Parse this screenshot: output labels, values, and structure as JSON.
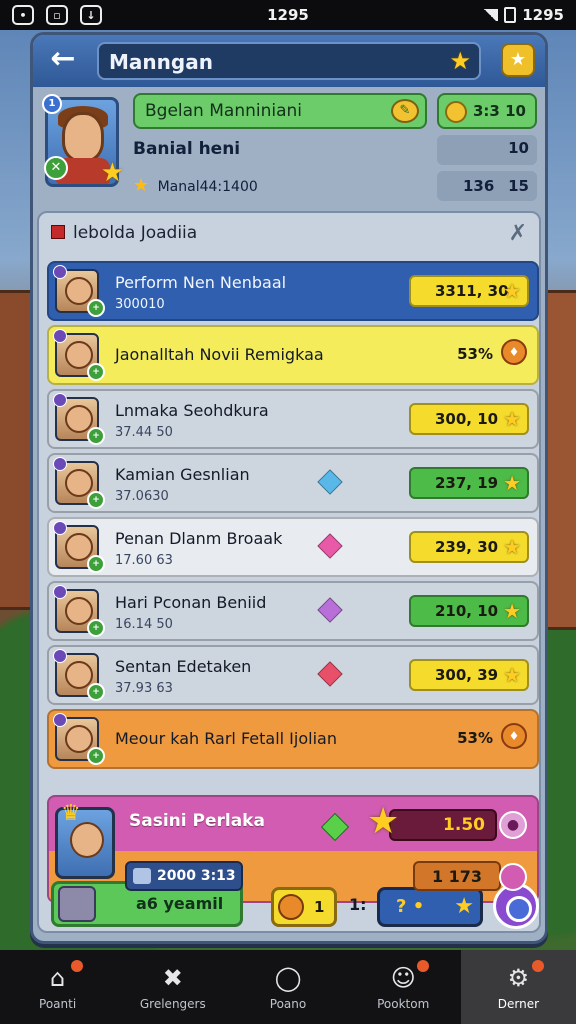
{
  "status_bar": {
    "time": "1295",
    "right_text": "1295"
  },
  "header": {
    "title": "Manngan"
  },
  "profile": {
    "name_bar": "Bgelan Manniniani",
    "coins": "3:3 10",
    "subtitle": "Banial heni",
    "subtitle_value": "10",
    "level_text": "Manal44:1400",
    "stat_a": "136",
    "stat_b": "15"
  },
  "list": {
    "title": "lebolda Joadiia",
    "rows": [
      {
        "name": "Perform Nen Nenbaal",
        "sub": "300010",
        "value": "3311, 30",
        "color": "blue",
        "kind": "value",
        "value_color": "yellow"
      },
      {
        "name": "Jaonalltah Novii Remigkaa",
        "sub": "",
        "value": "53%",
        "color": "yellow",
        "kind": "percent"
      },
      {
        "name": "Lnmaka Seohdkura",
        "sub": "37.44 50",
        "value": "300, 10",
        "color": "grey",
        "kind": "value",
        "value_color": "yellow"
      },
      {
        "name": "Kamian Gesnlian",
        "sub": "37.0630",
        "value": "237, 19",
        "color": "grey",
        "kind": "value",
        "value_color": "green",
        "gem": "#5ab8e8"
      },
      {
        "name": "Penan Dlanm Broaak",
        "sub": "17.60 63",
        "value": "239, 30",
        "color": "light",
        "kind": "value",
        "value_color": "yellow",
        "gem": "#e85aa8"
      },
      {
        "name": "Hari Pconan Beniid",
        "sub": "16.14 50",
        "value": "210, 10",
        "color": "grey",
        "kind": "value",
        "value_color": "green",
        "gem": "#b870d8"
      },
      {
        "name": "Sentan Edetaken",
        "sub": "37.93 63",
        "value": "300, 39",
        "color": "grey",
        "kind": "value",
        "value_color": "yellow",
        "gem": "#e8506a"
      },
      {
        "name": "Meour kah Rarl Fetall Ijolian",
        "sub": "",
        "value": "53%",
        "color": "orange",
        "kind": "percent"
      }
    ],
    "feature": {
      "name": "Sasini Perlaka",
      "timer": "1.50",
      "chip": "2000 3:13",
      "count": "1 173"
    }
  },
  "actions": {
    "green_label": "a6 yeamil",
    "yellow_label": "1",
    "mid_label": "1:",
    "blue_label": "? •"
  },
  "nav": [
    {
      "label": "Poanti",
      "icon": "home-icon",
      "glyph": "⌂",
      "dot": true,
      "active": false
    },
    {
      "label": "Grelengers",
      "icon": "crossed-swords-icon",
      "glyph": "✖",
      "dot": false,
      "active": false
    },
    {
      "label": "Poano",
      "icon": "circle-icon",
      "glyph": "◯",
      "dot": false,
      "active": false
    },
    {
      "label": "Pooktom",
      "icon": "person-icon",
      "glyph": "☺",
      "dot": true,
      "active": false
    },
    {
      "label": "Derner",
      "icon": "gear-icon",
      "glyph": "⚙",
      "dot": true,
      "active": true
    }
  ],
  "colors": {
    "row_blue": "#2f5fae",
    "row_yellow": "#f4ec5a",
    "row_grey": "#cdd5df",
    "row_light": "#e8ecf1",
    "row_orange": "#ef9a3e",
    "feature_pink": "#d25cb2",
    "value_yellow": "#f5dc2c",
    "value_green": "#4cbb48"
  }
}
